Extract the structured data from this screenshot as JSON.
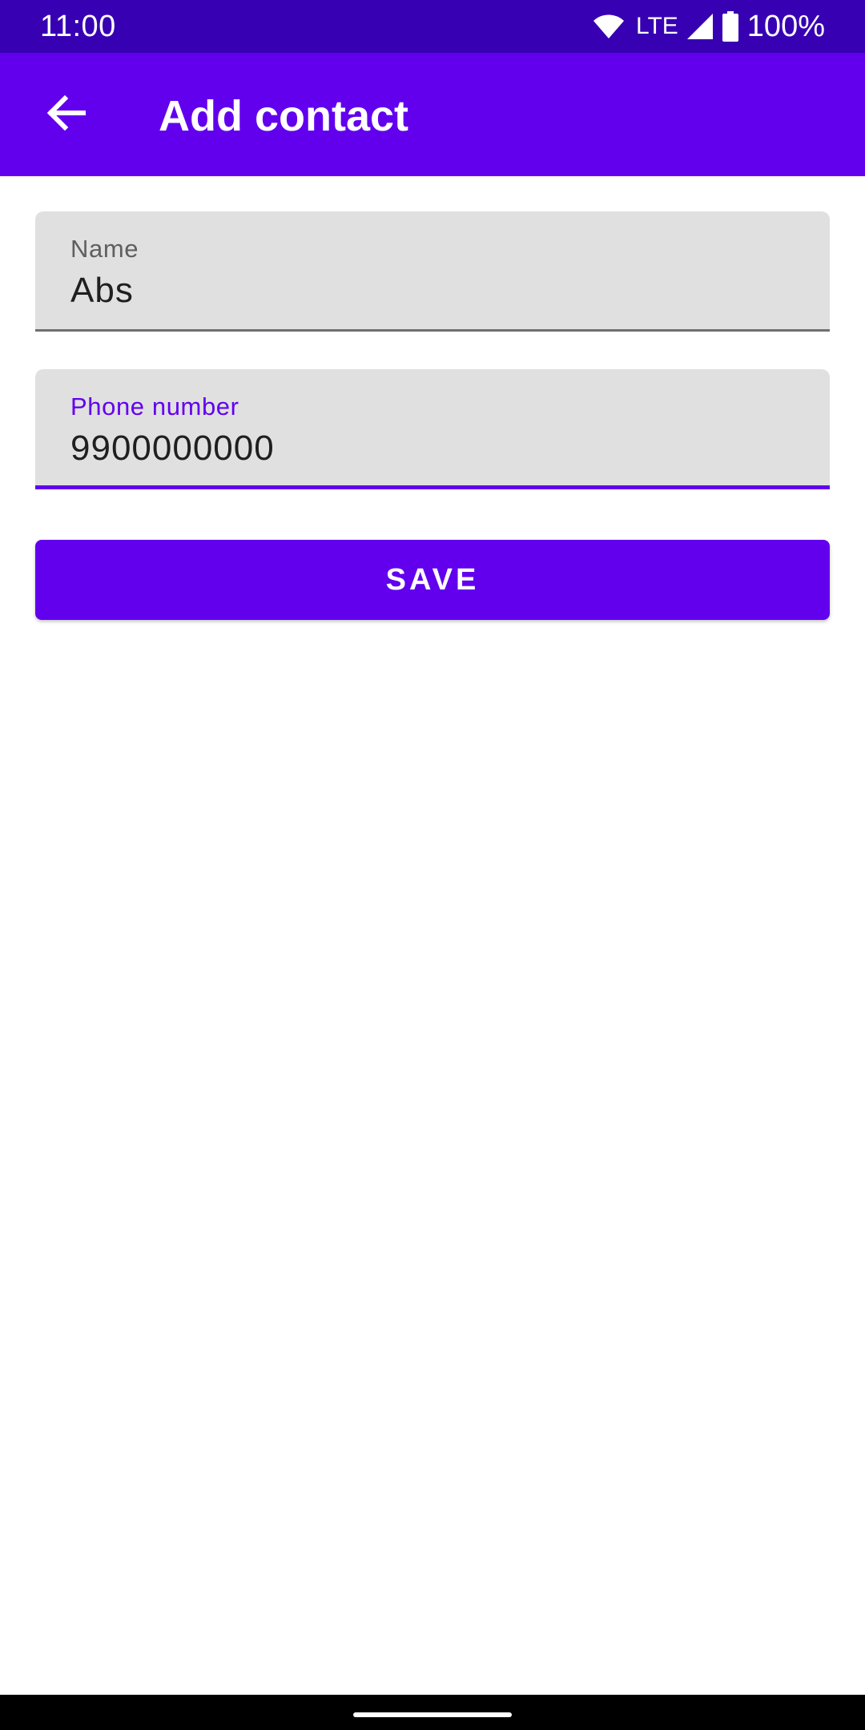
{
  "status_bar": {
    "time": "11:00",
    "network": "LTE",
    "battery": "100%",
    "icons": [
      "wifi-icon",
      "signal-icon",
      "battery-icon"
    ]
  },
  "app_bar": {
    "title": "Add contact",
    "back_icon": "arrow-back-icon"
  },
  "form": {
    "name": {
      "label": "Name",
      "value": "Abs"
    },
    "phone": {
      "label": "Phone number",
      "value": "9900000000",
      "focused": true
    },
    "save_label": "SAVE"
  },
  "colors": {
    "status_bar": "#3700b3",
    "primary": "#6200ee",
    "field_background": "#e0e0e0",
    "background": "#ffffff"
  }
}
